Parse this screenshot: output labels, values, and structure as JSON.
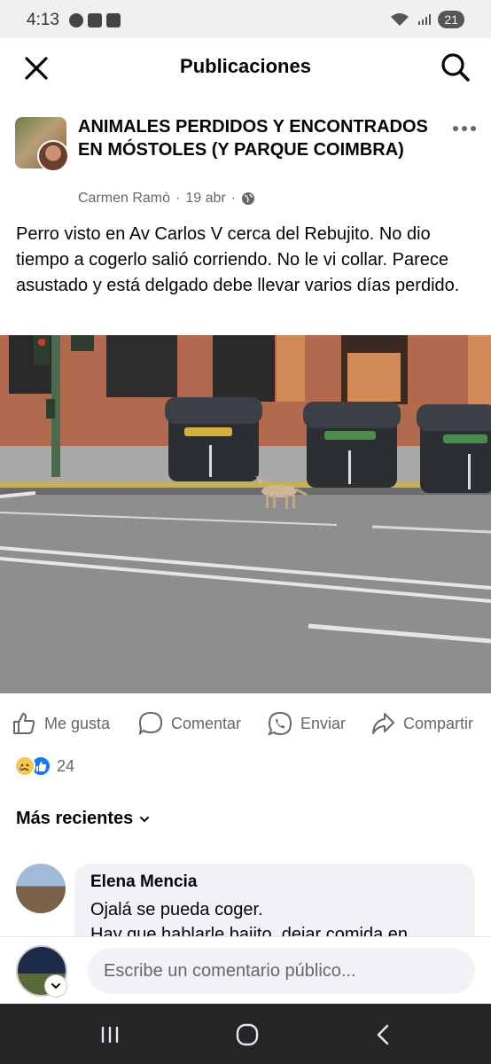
{
  "status_bar": {
    "time": "4:13",
    "battery": "21"
  },
  "header": {
    "title": "Publicaciones"
  },
  "post": {
    "group_name": "ANIMALES PERDIDOS Y ENCONTRADOS EN MÓSTOLES  (Y PARQUE COIMBRA)",
    "author": "Carmen Ramò",
    "date": "19 abr",
    "separator": "·",
    "text": "Perro visto en Av Carlos V cerca del Rebujito. No dio tiempo a cogerlo salió corriendo. No le vi collar. Parece asustado y está delgado debe llevar varios días perdido."
  },
  "actions": {
    "like_label": "Me gusta",
    "comment_label": "Comentar",
    "send_label": "Enviar",
    "share_label": "Compartir"
  },
  "reactions": {
    "count": "24"
  },
  "comments_sort": {
    "label": "Más recientes"
  },
  "comments": [
    {
      "author": "Elena Mencia",
      "text_line1": "Ojalá se pueda coger.",
      "text_line2": "Hay que hablarle bajito, dejar comida en"
    }
  ],
  "composer": {
    "placeholder": "Escribe un comentario público..."
  },
  "colors": {
    "accent": "#1877f2",
    "text_secondary": "#65676b",
    "bubble": "#f0f2f5"
  }
}
